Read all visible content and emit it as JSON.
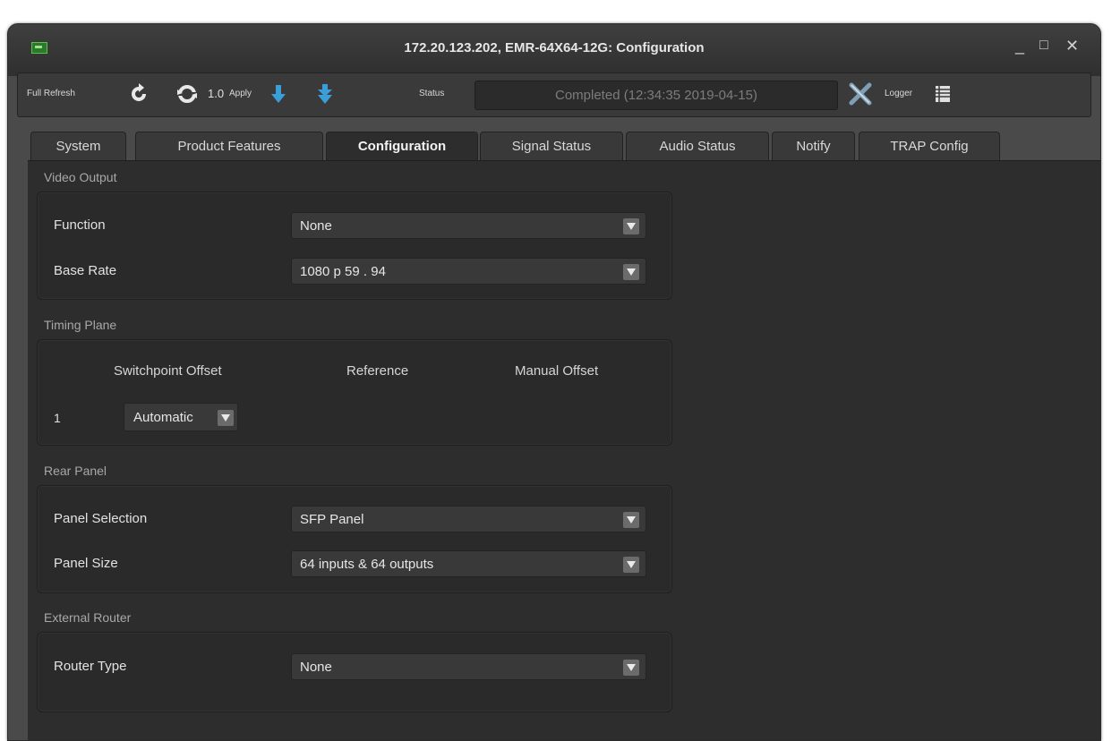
{
  "window": {
    "title": "172.20.123.202, EMR-64X64-12G: Configuration",
    "controls": [
      "_",
      "□",
      "✕"
    ]
  },
  "toolbar": {
    "full_refresh_label": "Full Refresh",
    "refresh_value": "1.0",
    "apply_label": "Apply",
    "status_label": "Status",
    "status_text": "Completed  (12:34:35 2019-04-15)",
    "logger_label": "Logger"
  },
  "tabs": [
    {
      "label": "System"
    },
    {
      "label": "Product Features"
    },
    {
      "label": "Configuration",
      "active": true
    },
    {
      "label": "Signal Status"
    },
    {
      "label": "Audio Status"
    },
    {
      "label": "Notify"
    },
    {
      "label": "TRAP Config"
    }
  ],
  "video_output": {
    "title": "Video Output",
    "function_label": "Function",
    "function_value": "None",
    "base_rate_label": "Base Rate",
    "base_rate_value": "1080 p 59 . 94"
  },
  "timing_plane": {
    "title": "Timing Plane",
    "col_switchpoint": "Switchpoint Offset",
    "col_reference": "Reference",
    "col_manual": "Manual Offset",
    "row_index": "1",
    "switchpoint_value": "Automatic"
  },
  "rear_panel": {
    "title": "Rear Panel",
    "selection_label": "Panel Selection",
    "selection_value": "SFP Panel",
    "size_label": "Panel Size",
    "size_value": "64 inputs & 64 outputs"
  },
  "external_router": {
    "title": "External Router",
    "type_label": "Router Type",
    "type_value": "None"
  },
  "colors": {
    "background": "#2d2d2d",
    "accent_arrow": "#3a9fd8",
    "close_x": "#7f9fb5"
  }
}
